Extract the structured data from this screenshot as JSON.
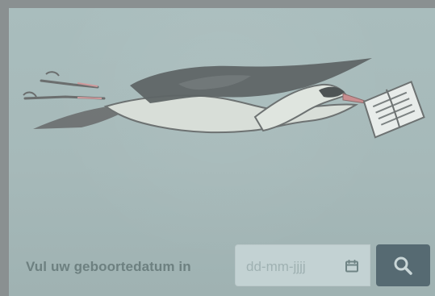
{
  "page": {
    "background_color": "#8a9091",
    "panel_color": "#a9bdbd"
  },
  "hero": {
    "illustration": "stork-carrying-newspaper"
  },
  "form": {
    "label": "Vul uw geboortedatum in",
    "date_placeholder": "dd-mm-jjjj",
    "calendar_icon": "calendar-icon",
    "search_icon": "search-icon",
    "search_button_color": "#566a72"
  }
}
